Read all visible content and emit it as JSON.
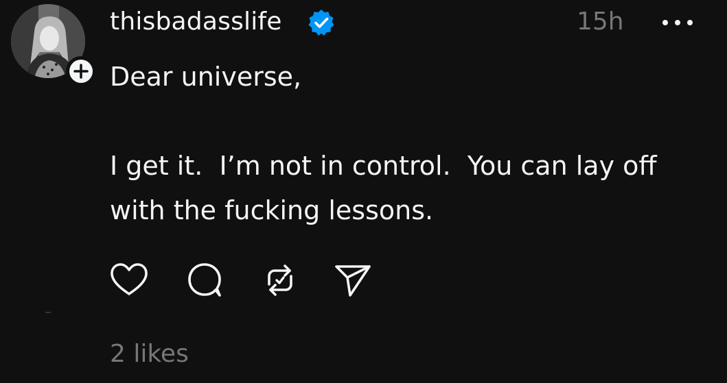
{
  "post": {
    "username": "thisbadasslife",
    "verified": true,
    "timestamp": "15h",
    "body": "Dear universe,\n\nI get it.  I’m not in control.  You can lay off\nwith the fucking lessons.",
    "likes_text": "2 likes"
  },
  "icons": {
    "verified": "verified-badge-icon",
    "more": "more-horizontal-icon",
    "follow": "plus-icon",
    "like": "heart-icon",
    "reply": "comment-bubble-icon",
    "repost": "repost-icon",
    "share": "send-icon"
  },
  "colors": {
    "background": "#101010",
    "primary_text": "#f3f5f7",
    "secondary_text": "#777777",
    "verified_blue": "#0095f6"
  }
}
